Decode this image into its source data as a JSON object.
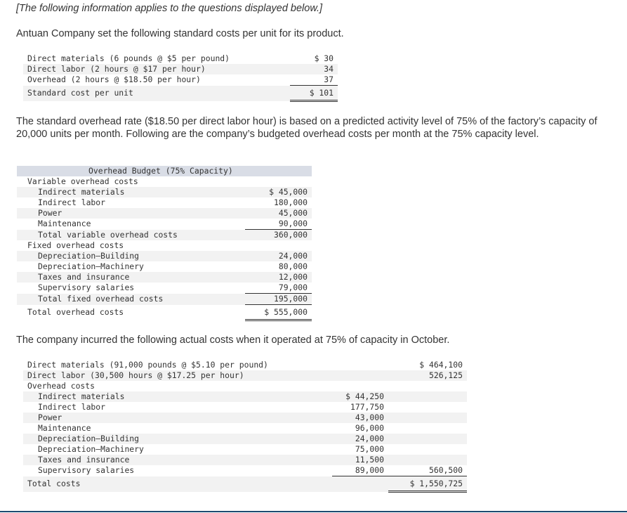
{
  "intro_note": "[The following information applies to the questions displayed below.]",
  "standard_costs": {
    "lead": "Antuan Company set the following standard costs per unit for its product.",
    "rows": [
      {
        "label": "Direct materials (6 pounds @ $5 per pound)",
        "value": "$ 30"
      },
      {
        "label": "Direct labor (2 hours @ $17 per hour)",
        "value": "34"
      },
      {
        "label": "Overhead (2 hours @ $18.50 per hour)",
        "value": "37"
      },
      {
        "label": "Standard cost per unit",
        "value": "$ 101"
      }
    ]
  },
  "overhead_paragraph": "The standard overhead rate ($18.50 per direct labor hour) is based on a predicted activity level of 75% of the factory’s capacity of 20,000 units per month. Following are the company’s budgeted overhead costs per month at the 75% capacity level.",
  "overhead_budget": {
    "title": "Overhead Budget (75% Capacity)",
    "variable_heading": "Variable overhead costs",
    "variable_rows": [
      {
        "label": "Indirect materials",
        "value": "$ 45,000"
      },
      {
        "label": "Indirect labor",
        "value": "180,000"
      },
      {
        "label": "Power",
        "value": "45,000"
      },
      {
        "label": "Maintenance",
        "value": "90,000"
      }
    ],
    "variable_total": {
      "label": "Total variable overhead costs",
      "value": "360,000"
    },
    "fixed_heading": "Fixed overhead costs",
    "fixed_rows": [
      {
        "label": "Depreciation—Building",
        "value": "24,000"
      },
      {
        "label": "Depreciation—Machinery",
        "value": "80,000"
      },
      {
        "label": "Taxes and insurance",
        "value": "12,000"
      },
      {
        "label": "Supervisory salaries",
        "value": "79,000"
      }
    ],
    "fixed_total": {
      "label": "Total fixed overhead costs",
      "value": "195,000"
    },
    "grand_total": {
      "label": "Total overhead costs",
      "value": "$ 555,000"
    }
  },
  "actual_paragraph": "The company incurred the following actual costs when it operated at 75% of capacity in October.",
  "actual_costs": {
    "direct_materials": {
      "label": "Direct materials (91,000 pounds @ $5.10 per pound)",
      "value": "$ 464,100"
    },
    "direct_labor": {
      "label": "Direct labor (30,500 hours @ $17.25 per hour)",
      "value": "526,125"
    },
    "overhead_heading": "Overhead costs",
    "overhead_rows": [
      {
        "label": "Indirect materials",
        "value": "$ 44,250"
      },
      {
        "label": "Indirect labor",
        "value": "177,750"
      },
      {
        "label": "Power",
        "value": "43,000"
      },
      {
        "label": "Maintenance",
        "value": "96,000"
      },
      {
        "label": "Depreciation—Building",
        "value": "24,000"
      },
      {
        "label": "Depreciation—Machinery",
        "value": "75,000"
      },
      {
        "label": "Taxes and insurance",
        "value": "11,500"
      },
      {
        "label": "Supervisory salaries",
        "value": "89,000"
      }
    ],
    "overhead_total": "560,500",
    "total": {
      "label": "Total costs",
      "value": "$ 1,550,725"
    }
  }
}
